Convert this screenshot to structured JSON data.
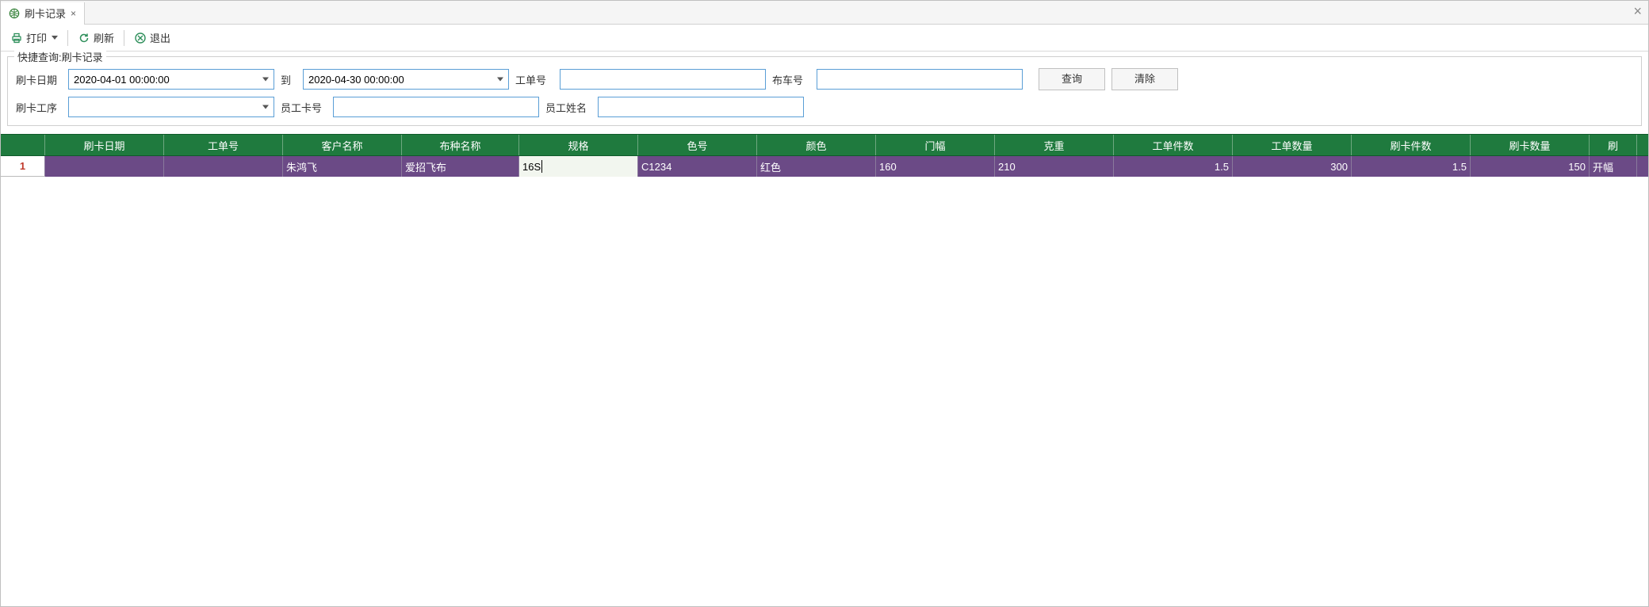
{
  "tab": {
    "title": "刷卡记录"
  },
  "toolbar": {
    "print_label": "打印",
    "refresh_label": "刷新",
    "exit_label": "退出"
  },
  "filter": {
    "legend": "快捷查询:刷卡记录",
    "date_label": "刷卡日期",
    "date_from": "2020-04-01 00:00:00",
    "date_to_lbl": "到",
    "date_to": "2020-04-30 00:00:00",
    "order_label": "工单号",
    "order_value": "",
    "cloth_label": "布车号",
    "cloth_value": "",
    "query_btn": "查询",
    "clear_btn": "清除",
    "process_label": "刷卡工序",
    "process_value": "",
    "empcard_label": "员工卡号",
    "empcard_value": "",
    "empname_label": "员工姓名",
    "empname_value": ""
  },
  "grid": {
    "headers": [
      "刷卡日期",
      "工单号",
      "客户名称",
      "布种名称",
      "规格",
      "色号",
      "颜色",
      "门幅",
      "克重",
      "工单件数",
      "工单数量",
      "刷卡件数",
      "刷卡数量",
      ""
    ],
    "last_header_partial": "刷",
    "rows": [
      {
        "index": "1",
        "cells": {
          "date": "",
          "order": "",
          "customer": "朱鸿飞",
          "cloth_type": "爱招飞布",
          "spec": "16S",
          "color_no": "C1234",
          "color": "红色",
          "width": "160",
          "weight": "210",
          "order_pieces": "1.5",
          "order_qty": "300",
          "swipe_pieces": "1.5",
          "swipe_qty": "150",
          "tail": "开幅"
        }
      }
    ]
  }
}
